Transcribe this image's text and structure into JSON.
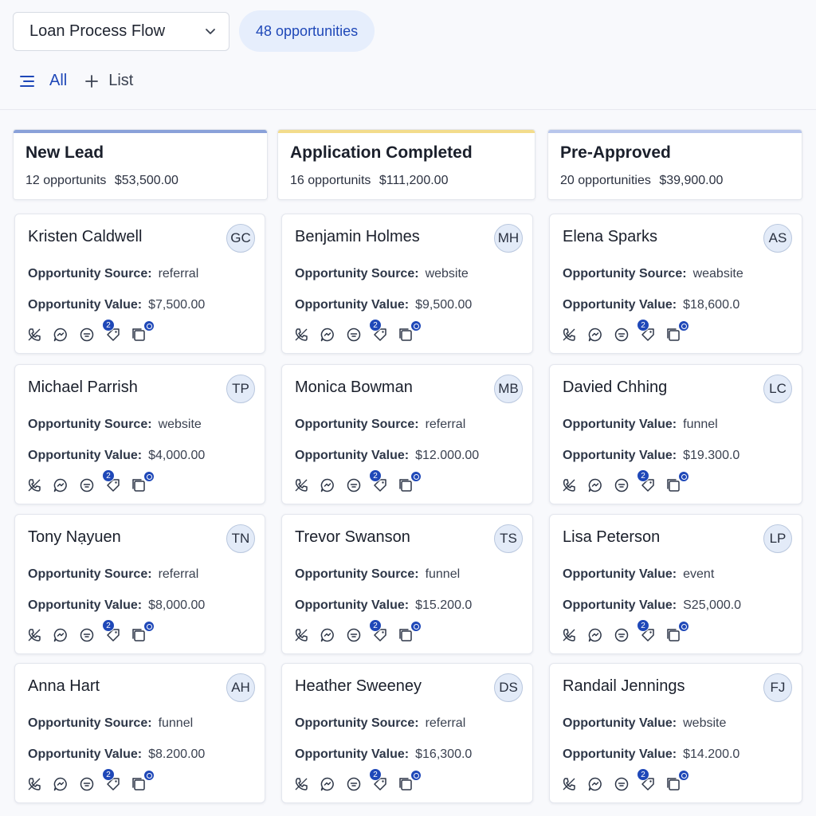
{
  "pipeline": {
    "selected": "Loan Process Flow"
  },
  "count_pill": "48 opportunities",
  "views": {
    "all": "All",
    "list": "List"
  },
  "accent": "#1f48b8",
  "columns": [
    {
      "title": "New Lead",
      "count": "12 opportunits",
      "total": "$53,500.00",
      "color": "#8aa1d9",
      "cards": [
        {
          "name": "Kristen Caldwell",
          "initials": "GC",
          "l1": "Opportunity Source:",
          "v1": "referral",
          "l2": "Opportunity Value:",
          "v2": "$7,500.00"
        },
        {
          "name": "Michael Parrish",
          "initials": "TP",
          "l1": "Opportunity Source:",
          "v1": "website",
          "l2": "Opportunity Value:",
          "v2": "$4,000.00"
        },
        {
          "name": "Tony Nạyuen",
          "initials": "TN",
          "l1": "Opportunity Source:",
          "v1": "referral",
          "l2": "Opportunity Value:",
          "v2": "$8,000.00"
        },
        {
          "name": "Anna Hart",
          "initials": "AH",
          "l1": "Opportunity Source:",
          "v1": "funnel",
          "l2": "Opportunity Value:",
          "v2": "$8.200.00"
        }
      ]
    },
    {
      "title": "Application Completed",
      "count": "16 opportunits",
      "total": "$111,200.00",
      "color": "#f3dc8c",
      "cards": [
        {
          "name": "Benjamin Holmes",
          "initials": "MH",
          "l1": "Opportunity Source:",
          "v1": "website",
          "l2": "Opportunity Value:",
          "v2": "$9,500.00"
        },
        {
          "name": "Monica Bowman",
          "initials": "MB",
          "l1": "Opportunity Source:",
          "v1": "referral",
          "l2": "Opportunity Value:",
          "v2": "$12.000.00"
        },
        {
          "name": "Trevor Swanson",
          "initials": "TS",
          "l1": "Opportunity Source:",
          "v1": "funnel",
          "l2": "Opportunity Value:",
          "v2": "$15.200.0"
        },
        {
          "name": "Heather Sweeney",
          "initials": "DS",
          "l1": "Opportunity Source:",
          "v1": "referral",
          "l2": "Opportunity Value:",
          "v2": "$16,300.0"
        }
      ]
    },
    {
      "title": "Pre-Approved",
      "count": "20 opportunities",
      "total": "$39,900.00",
      "color": "#b8c6ec",
      "cards": [
        {
          "name": "Elena Sparks",
          "initials": "AS",
          "l1": "Opportunity Source:",
          "v1": "weabsite",
          "l2": "Opportunity Value:",
          "v2": "$18,600.0"
        },
        {
          "name": "Davied  Chhing",
          "initials": "LC",
          "l1": "Opportunity Value:",
          "v1": "funnel",
          "l2": "Opportunity Value:",
          "v2": "$19.300.0"
        },
        {
          "name": "Lisa Peterson",
          "initials": "LP",
          "l1": "Opportunity Value:",
          "v1": "event",
          "l2": "Opportunity Value:",
          "v2": "S25,000.0"
        },
        {
          "name": "Randail Jennings",
          "initials": "FJ",
          "l1": "Opportunity Value:",
          "v1": "website",
          "l2": "Opportunity Value:",
          "v2": "$14.200.0"
        }
      ]
    }
  ],
  "card_icons": [
    "phone-icon",
    "chat-icon",
    "message-icon",
    "tag-icon",
    "task-icon"
  ],
  "tag_badge": "2"
}
